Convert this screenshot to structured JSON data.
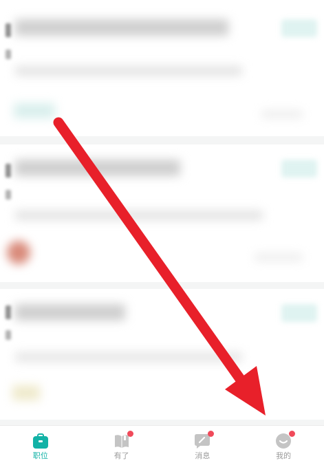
{
  "tabbar": {
    "items": [
      {
        "label": "职位",
        "icon": "briefcase-icon",
        "active": true,
        "badge": false
      },
      {
        "label": "有了",
        "icon": "book-icon",
        "active": false,
        "badge": true
      },
      {
        "label": "消息",
        "icon": "chat-icon",
        "active": false,
        "badge": true
      },
      {
        "label": "我的",
        "icon": "profile-icon",
        "active": false,
        "badge": true
      }
    ]
  },
  "colors": {
    "accent": "#12b2a6",
    "badge": "#f04a5a",
    "inactive": "#c4c4c4",
    "arrow": "#e8202a"
  }
}
